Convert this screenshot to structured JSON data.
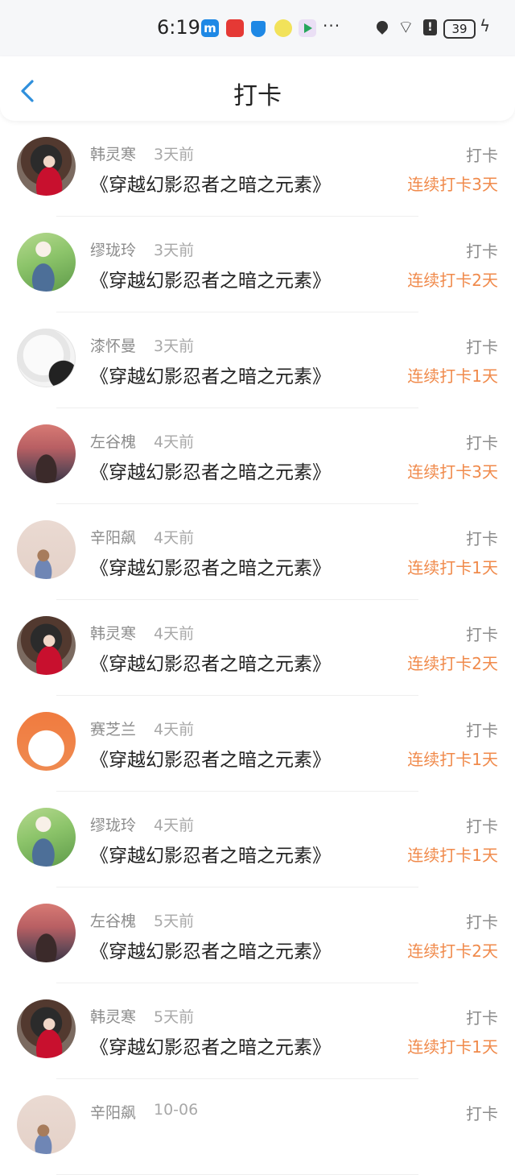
{
  "status_bar": {
    "time": "6:19",
    "app_m_label": "m",
    "battery": "39",
    "alert": "!",
    "dots": "···",
    "bolt": "ϟ",
    "wifi": "⌔"
  },
  "header": {
    "title": "打卡"
  },
  "items": [
    {
      "name": "韩灵寒",
      "ago": "3天前",
      "book": "《穿越幻影忍者之暗之元素》",
      "action": "打卡",
      "streak": "连续打卡3天",
      "avatar": "han"
    },
    {
      "name": "缪珑玲",
      "ago": "3天前",
      "book": "《穿越幻影忍者之暗之元素》",
      "action": "打卡",
      "streak": "连续打卡2天",
      "avatar": "miao"
    },
    {
      "name": "漆怀曼",
      "ago": "3天前",
      "book": "《穿越幻影忍者之暗之元素》",
      "action": "打卡",
      "streak": "连续打卡1天",
      "avatar": "qi"
    },
    {
      "name": "左谷槐",
      "ago": "4天前",
      "book": "《穿越幻影忍者之暗之元素》",
      "action": "打卡",
      "streak": "连续打卡3天",
      "avatar": "zuo"
    },
    {
      "name": "辛阳飙",
      "ago": "4天前",
      "book": "《穿越幻影忍者之暗之元素》",
      "action": "打卡",
      "streak": "连续打卡1天",
      "avatar": "xin"
    },
    {
      "name": "韩灵寒",
      "ago": "4天前",
      "book": "《穿越幻影忍者之暗之元素》",
      "action": "打卡",
      "streak": "连续打卡2天",
      "avatar": "han"
    },
    {
      "name": "赛芝兰",
      "ago": "4天前",
      "book": "《穿越幻影忍者之暗之元素》",
      "action": "打卡",
      "streak": "连续打卡1天",
      "avatar": "sai"
    },
    {
      "name": "缪珑玲",
      "ago": "4天前",
      "book": "《穿越幻影忍者之暗之元素》",
      "action": "打卡",
      "streak": "连续打卡1天",
      "avatar": "miao"
    },
    {
      "name": "左谷槐",
      "ago": "5天前",
      "book": "《穿越幻影忍者之暗之元素》",
      "action": "打卡",
      "streak": "连续打卡2天",
      "avatar": "zuo"
    },
    {
      "name": "韩灵寒",
      "ago": "5天前",
      "book": "《穿越幻影忍者之暗之元素》",
      "action": "打卡",
      "streak": "连续打卡1天",
      "avatar": "han"
    },
    {
      "name": "辛阳飙",
      "ago": "10-06",
      "book": "",
      "action": "打卡",
      "streak": "",
      "avatar": "xin"
    }
  ],
  "colors": {
    "accent": "#f08a4b",
    "back_arrow": "#2f8fdc",
    "muted_text": "#8c8c8c"
  }
}
